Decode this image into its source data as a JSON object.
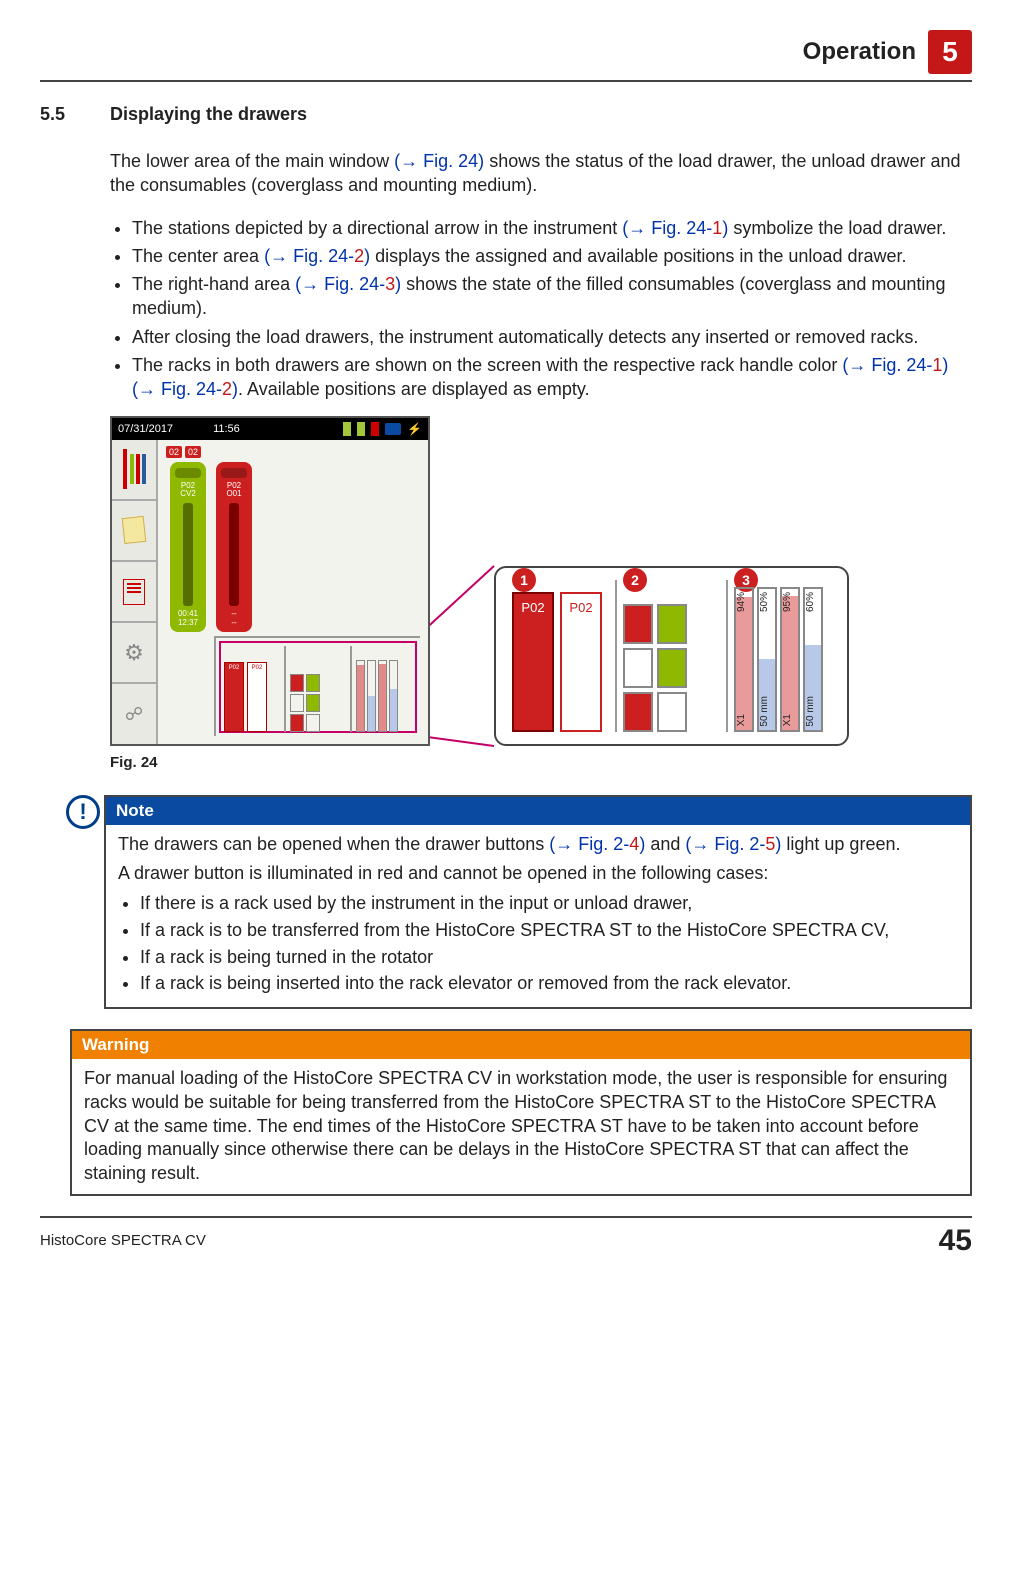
{
  "header": {
    "title": "Operation",
    "chapter": "5"
  },
  "section": {
    "number": "5.5",
    "title": "Displaying the drawers"
  },
  "intro": {
    "pre": "The lower area of the main window ",
    "ref": "(→ Fig.  24)",
    "post": " shows the status of the load drawer, the unload drawer and the consumables (coverglass and mounting medium)."
  },
  "bullets": [
    {
      "pre": "The stations depicted by a directional arrow in the instrument ",
      "ref": "(→ Fig.  24",
      "dash": "-",
      "num": "1",
      "close": ")",
      "post": " symbolize the load drawer."
    },
    {
      "pre": "The center area ",
      "ref": "(→ Fig.  24",
      "dash": "-",
      "num": "2",
      "close": ")",
      "post": " displays the assigned and available positions in the unload drawer."
    },
    {
      "pre": "The right-hand area ",
      "ref": "(→ Fig.  24",
      "dash": "-",
      "num": "3",
      "close": ")",
      "post": " shows the state of the filled consumables (coverglass and mounting medium)."
    },
    {
      "pre": "After closing the load drawers, the instrument automatically detects any inserted or removed racks.",
      "ref": "",
      "dash": "",
      "num": "",
      "close": "",
      "post": ""
    },
    {
      "pre": "The racks in both drawers are shown on the screen with the respective rack handle color ",
      "ref": "(→ Fig.  24",
      "dash": "-",
      "num": "1",
      "close": ")",
      "ref2": " (→ Fig.  24",
      "dash2": "-",
      "num2": "2",
      "close2": ")",
      "post": ". Available positions are displayed as empty."
    }
  ],
  "screen": {
    "date": "07/31/2017",
    "time": "11:56",
    "top_badges": [
      "02",
      "02"
    ],
    "green_rack": {
      "l1": "P02",
      "l2": "CV2",
      "foot1": "00:41",
      "foot2": "12:37"
    },
    "red_rack": {
      "l1": "P02",
      "l2": "O01",
      "foot1": "--",
      "foot2": "--"
    },
    "mini": {
      "r1": "P02",
      "r2": "P02"
    }
  },
  "zoom": {
    "markers": [
      "1",
      "2",
      "3"
    ],
    "col1": {
      "a": "P02",
      "b": "P02"
    },
    "bars": [
      {
        "top": "94%",
        "bot": "X1",
        "fill": 94,
        "cls": "red"
      },
      {
        "top": "50%",
        "bot": "50 mm",
        "fill": 50,
        "cls": "blue"
      },
      {
        "top": "95%",
        "bot": "X1",
        "fill": 95,
        "cls": "red"
      },
      {
        "top": "60%",
        "bot": "50 mm",
        "fill": 60,
        "cls": "blue"
      }
    ]
  },
  "fig_caption": "Fig.  24",
  "note": {
    "title": "Note",
    "line1_pre": "The drawers can be opened when the drawer buttons ",
    "line1_ref1": "(→ Fig.  2",
    "line1_d1": "-",
    "line1_n1": "4",
    "line1_c1": ")",
    "line1_mid": " and ",
    "line1_ref2": "(→ Fig.  2",
    "line1_d2": "-",
    "line1_n2": "5",
    "line1_c2": ")",
    "line1_post": " light up green.",
    "line2": "A drawer button is illuminated in red and cannot be opened in the following cases:",
    "items": [
      "If there is a rack used by the instrument in the input or unload drawer,",
      "If a rack is to be transferred from the HistoCore SPECTRA ST to the HistoCore SPECTRA CV,",
      "If a rack is being turned in the rotator",
      "If a rack is being inserted into the rack elevator or removed from the rack elevator."
    ]
  },
  "warning": {
    "title": "Warning",
    "body": "For manual loading of the HistoCore SPECTRA CV in workstation mode, the user is responsible for ensuring racks would be suitable for being transferred from the HistoCore SPECTRA ST to the HistoCore SPECTRA CV at the same time. The end times of the HistoCore SPECTRA ST have to be taken into account before loading manually since otherwise there can be delays in the HistoCore SPECTRA ST that can affect the staining result."
  },
  "footer": {
    "product": "HistoCore SPECTRA CV",
    "page": "45"
  }
}
